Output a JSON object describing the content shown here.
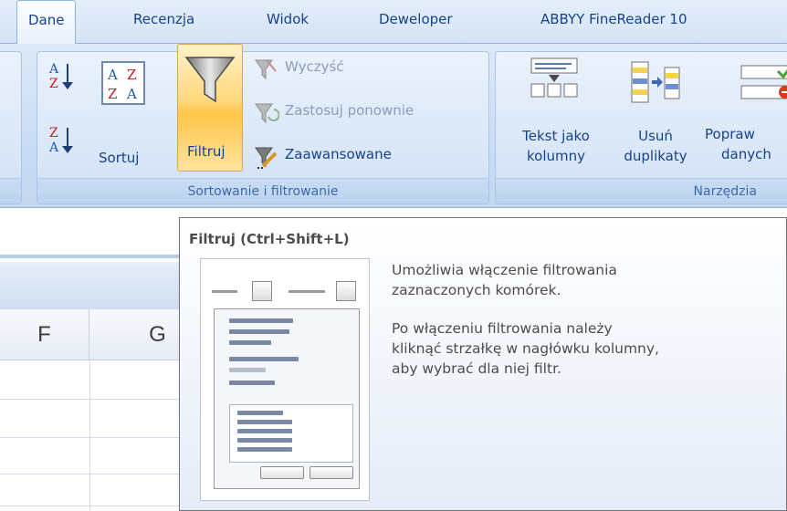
{
  "tabs": [
    {
      "label": "Dane",
      "active": true
    },
    {
      "label": "Recenzja",
      "active": false
    },
    {
      "label": "Widok",
      "active": false
    },
    {
      "label": "Deweloper",
      "active": false
    },
    {
      "label": "ABBYY FineReader 10",
      "active": false
    }
  ],
  "sort_filter_group": {
    "caption": "Sortowanie i filtrowanie",
    "sort_az_icon": "sort-a-to-z-icon",
    "sort_za_icon": "sort-z-to-a-icon",
    "sort_label": "Sortuj",
    "filter_label": "Filtruj",
    "clear_label": "Wyczyść",
    "reapply_label": "Zastosuj ponownie",
    "advanced_label": "Zaawansowane"
  },
  "tools_group": {
    "caption": "Narzędzia",
    "text_to_columns": [
      "Tekst jako",
      "kolumny"
    ],
    "remove_duplicates": [
      "Usuń",
      "duplikaty"
    ],
    "data_validation": [
      "Popraw",
      "danych"
    ]
  },
  "sheet": {
    "columns": [
      "F",
      "G"
    ]
  },
  "tooltip": {
    "title": "Filtruj (Ctrl+Shift+L)",
    "lines": [
      "Umożliwia włączenie filtrowania",
      "zaznaczonych komórek.",
      "Po włączeniu filtrowania należy",
      "kliknąć strzałkę w nagłówku kolumny,",
      "aby wybrać dla niej filtr."
    ]
  },
  "colors": {
    "ribbon_text": "#15428b",
    "filter_highlight": "#ffc64a",
    "tooltip_text": "#4c4c4c"
  }
}
